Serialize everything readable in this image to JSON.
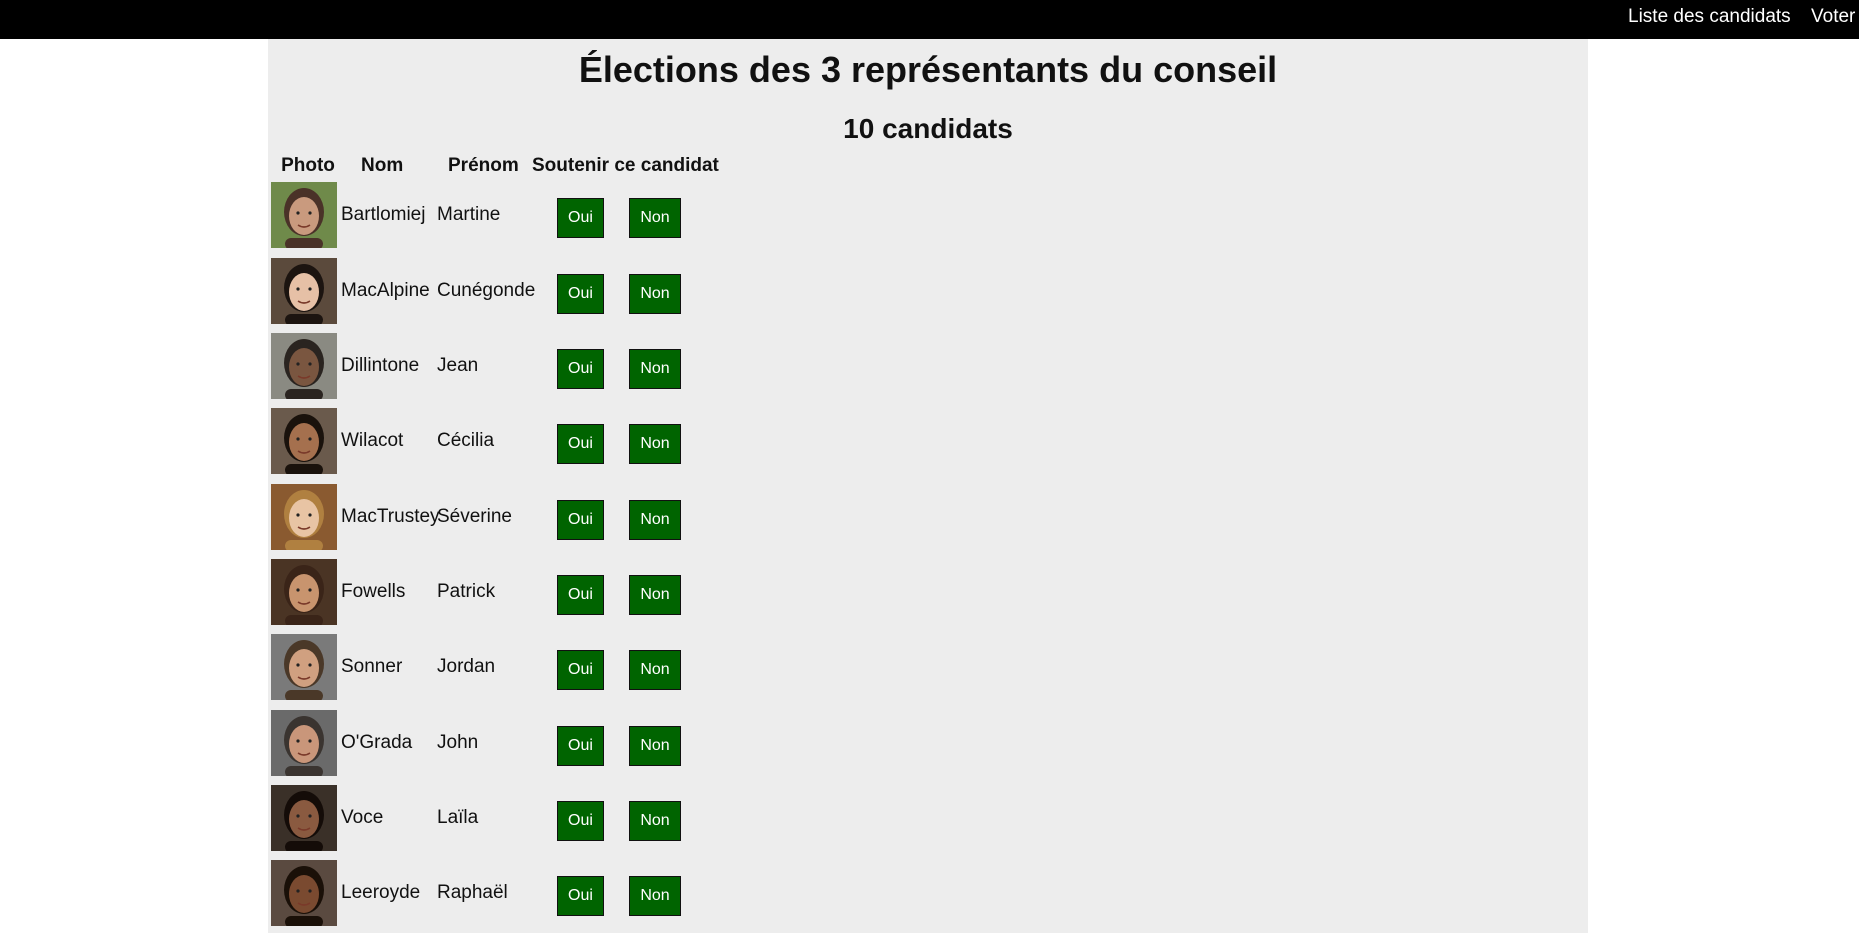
{
  "nav": {
    "candidates_link": "Liste des candidats",
    "vote_link": "Voter"
  },
  "page": {
    "title": "Élections des 3 représentants du conseil",
    "subtitle": "10 candidats"
  },
  "table": {
    "headers": {
      "photo": "Photo",
      "nom": "Nom",
      "prenom": "Prénom",
      "support": "Soutenir ce candidat"
    },
    "yes_label": "Oui",
    "no_label": "Non",
    "rows": [
      {
        "nom": "Bartlomiej",
        "prenom": "Martine"
      },
      {
        "nom": "MacAlpine",
        "prenom": "Cunégonde"
      },
      {
        "nom": "Dillintone",
        "prenom": "Jean"
      },
      {
        "nom": "Wilacot",
        "prenom": "Cécilia"
      },
      {
        "nom": "MacTrustey",
        "prenom": "Séverine"
      },
      {
        "nom": "Fowells",
        "prenom": "Patrick"
      },
      {
        "nom": "Sonner",
        "prenom": "Jordan"
      },
      {
        "nom": "O'Grada",
        "prenom": "John"
      },
      {
        "nom": "Voce",
        "prenom": "Laïla"
      },
      {
        "nom": "Leeroyde",
        "prenom": "Raphaël"
      }
    ]
  },
  "colors": {
    "topbar": "#000000",
    "content_bg": "#ededed",
    "button_bg": "#006400",
    "button_text": "#ffffff"
  }
}
